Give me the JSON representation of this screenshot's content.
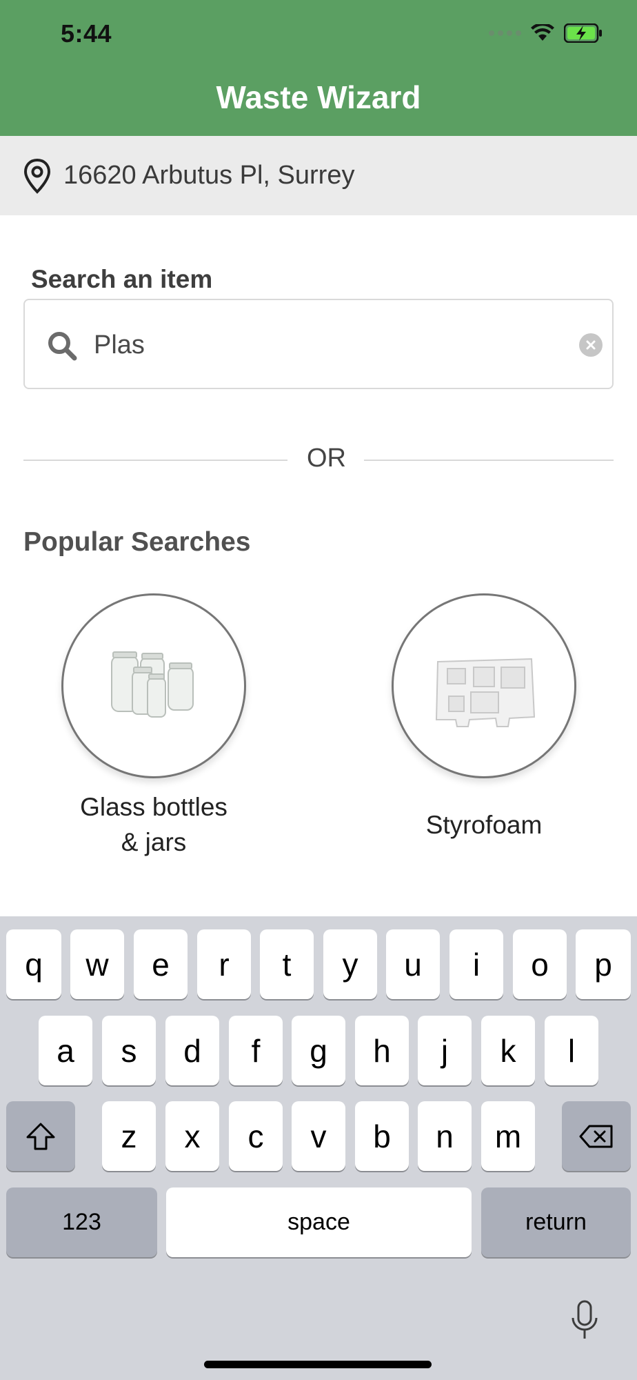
{
  "status_bar": {
    "time": "5:44"
  },
  "header": {
    "title": "Waste Wizard"
  },
  "address": {
    "text": "16620 Arbutus Pl, Surrey"
  },
  "search": {
    "label": "Search an item",
    "value": "Plas"
  },
  "divider": {
    "text": "OR"
  },
  "popular": {
    "title": "Popular Searches",
    "items": [
      {
        "label_line1": "Glass bottles",
        "label_line2": "& jars"
      },
      {
        "label_line1": "Styrofoam",
        "label_line2": ""
      }
    ]
  },
  "keyboard": {
    "row1": [
      "q",
      "w",
      "e",
      "r",
      "t",
      "y",
      "u",
      "i",
      "o",
      "p"
    ],
    "row2": [
      "a",
      "s",
      "d",
      "f",
      "g",
      "h",
      "j",
      "k",
      "l"
    ],
    "row3": [
      "z",
      "x",
      "c",
      "v",
      "b",
      "n",
      "m"
    ],
    "numbers_key": "123",
    "space_key": "space",
    "return_key": "return"
  },
  "colors": {
    "header_green": "#5b9f62",
    "address_bg": "#ebebeb",
    "keyboard_bg": "#d2d4da"
  }
}
